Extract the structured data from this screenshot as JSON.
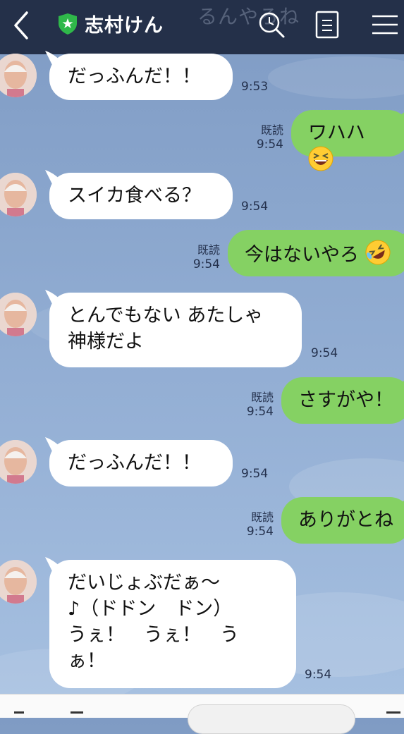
{
  "header": {
    "title": "志村けん",
    "ghost_text": "るんやろね",
    "colors": {
      "bar": "#243049",
      "shield": "#2fb84a"
    },
    "icons": [
      "back-chevron-icon",
      "shield-star-icon",
      "search-icon",
      "note-icon",
      "menu-icon"
    ]
  },
  "messages": [
    {
      "dir": "in",
      "text": "だっふんだ！！",
      "time": "9:53"
    },
    {
      "dir": "out",
      "text": "ワハハ",
      "emoji": "grinning-squinting-face",
      "read": "既読",
      "time": "9:54"
    },
    {
      "dir": "in",
      "text": "スイカ食べる？",
      "time": "9:54"
    },
    {
      "dir": "out",
      "text": "今はないやろ",
      "emoji": "rolling-on-floor-laughing-face",
      "read": "既読",
      "time": "9:54"
    },
    {
      "dir": "in",
      "text": "とんでもない あたしゃ\n神様だよ",
      "time": "9:54"
    },
    {
      "dir": "out",
      "text": "さすがや！",
      "read": "既読",
      "time": "9:54"
    },
    {
      "dir": "in",
      "text": "だっふんだ！！",
      "time": "9:54"
    },
    {
      "dir": "out",
      "text": "ありがとね",
      "read": "既読",
      "time": "9:54"
    },
    {
      "dir": "in",
      "text": "だいじょぶだぁ〜\n♪（ドドン　ドン）\nうぇ！　うぇ！　う\nぁ！",
      "time": "9:54"
    }
  ],
  "colors": {
    "bubble_out": "#85d163",
    "bubble_in": "#ffffff",
    "background": "#8aa6cd"
  }
}
